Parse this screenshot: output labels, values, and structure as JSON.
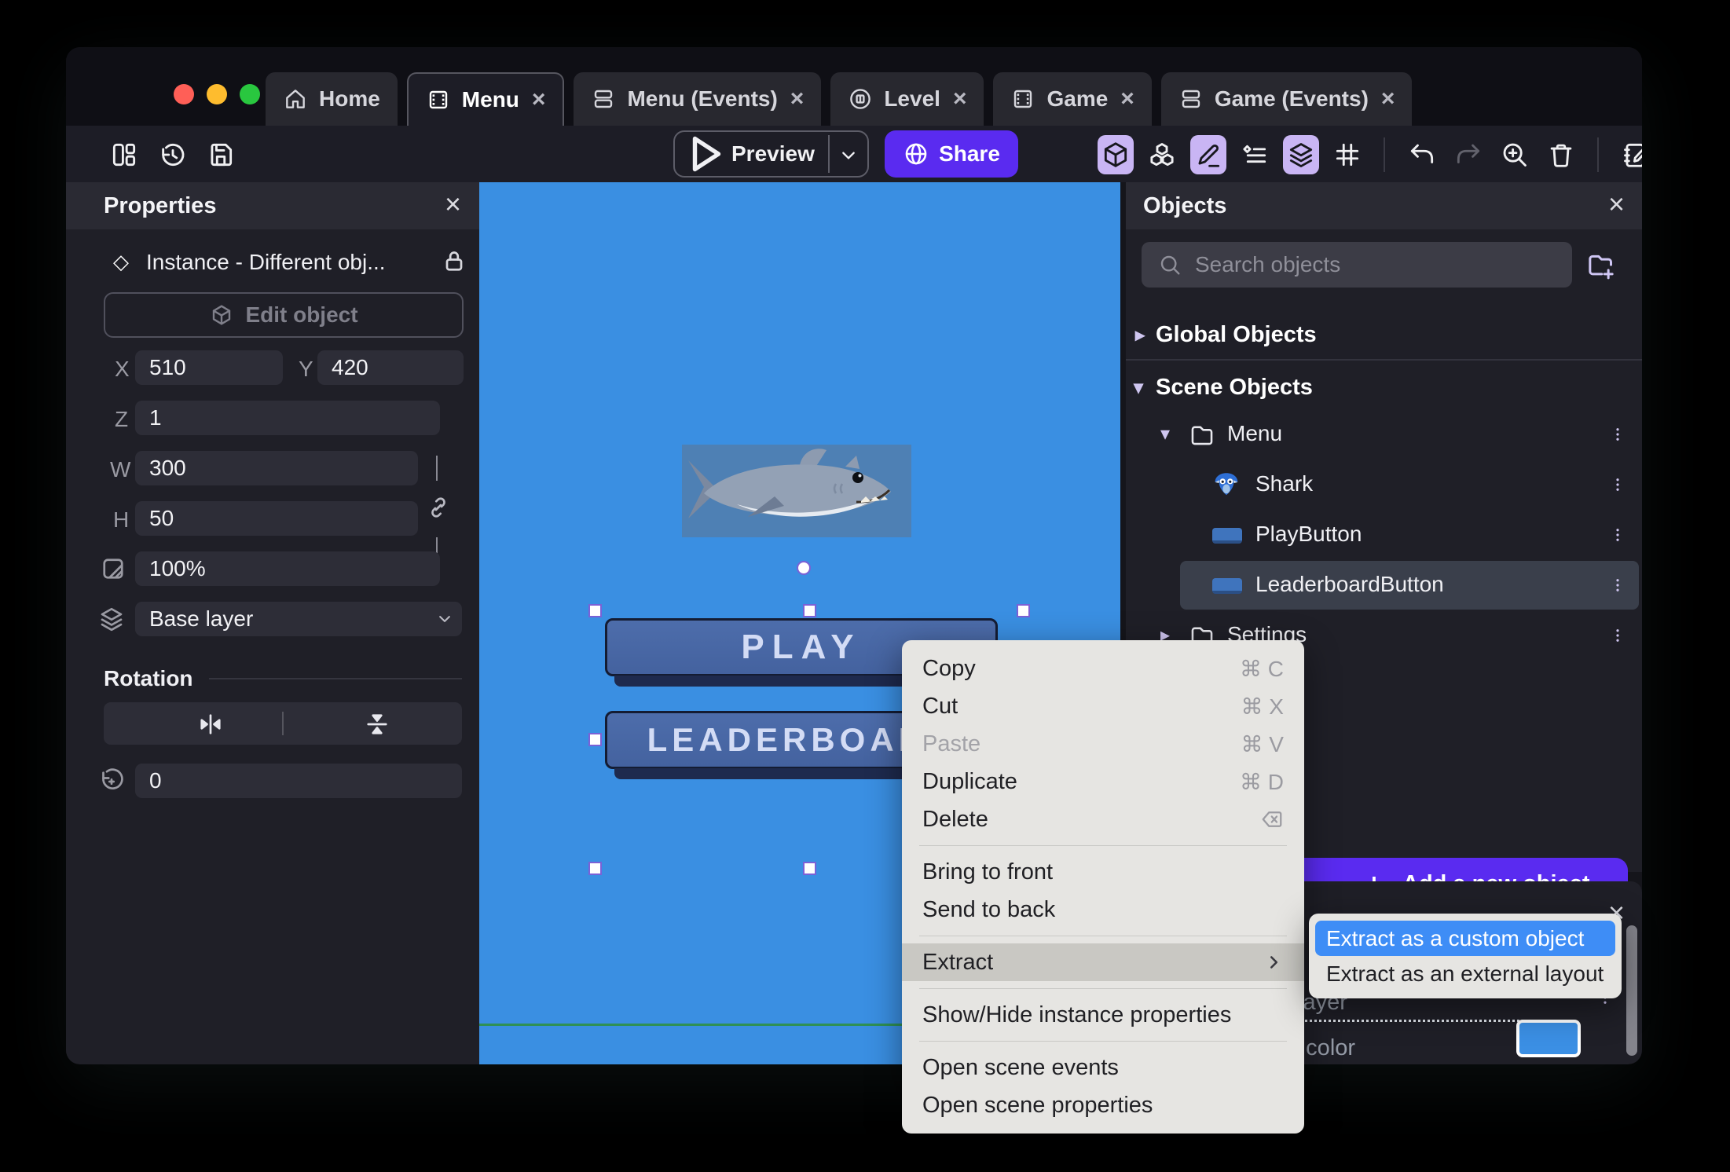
{
  "window_controls": {
    "close": "#ff5f57",
    "minimize": "#febc2e",
    "zoom": "#29c73f"
  },
  "tabs": [
    {
      "label": "Home",
      "icon": "home",
      "closable": false,
      "active": false
    },
    {
      "label": "Menu",
      "icon": "scene",
      "closable": true,
      "active": true
    },
    {
      "label": "Menu (Events)",
      "icon": "events",
      "closable": true,
      "active": false
    },
    {
      "label": "Level",
      "icon": "level",
      "closable": true,
      "active": false
    },
    {
      "label": "Game",
      "icon": "scene",
      "closable": true,
      "active": false
    },
    {
      "label": "Game (Events)",
      "icon": "events",
      "closable": true,
      "active": false
    }
  ],
  "toolbar": {
    "preview_label": "Preview",
    "share_label": "Share",
    "left_icons": [
      "panels",
      "history",
      "save"
    ],
    "right_icons": [
      {
        "name": "cube",
        "active": true
      },
      {
        "name": "cubes",
        "active": false
      },
      {
        "name": "pencil",
        "active": true
      },
      {
        "name": "instances",
        "active": false
      },
      {
        "name": "layers",
        "active": true
      },
      {
        "name": "grid",
        "active": false
      },
      {
        "divider": true
      },
      {
        "name": "undo",
        "active": false
      },
      {
        "name": "redo",
        "active": false,
        "dim": true
      },
      {
        "name": "zoomin",
        "active": false
      },
      {
        "name": "trash",
        "active": false
      },
      {
        "divider": true
      },
      {
        "name": "notebook",
        "active": false
      }
    ]
  },
  "properties_panel": {
    "title": "Properties",
    "instance_label": "Instance  -  Different obj...",
    "edit_object_label": "Edit object",
    "x_label": "X",
    "x_value": "510",
    "y_label": "Y",
    "y_value": "420",
    "z_label": "Z",
    "z_value": "1",
    "w_label": "W",
    "w_value": "300",
    "h_label": "H",
    "h_value": "50",
    "opacity_value": "100%",
    "layer_value": "Base layer",
    "rotation_title": "Rotation",
    "rotation_value": "0"
  },
  "canvas": {
    "background": "#3a8fe2",
    "play_button_label": "PLAY",
    "leaderboard_button_label": "LEADERBOARD",
    "scene_bottom_line_color": "#2f9055"
  },
  "objects_panel": {
    "title": "Objects",
    "search_placeholder": "Search objects",
    "global_section": "Global Objects",
    "scene_section": "Scene Objects",
    "tree": [
      {
        "label": "Menu",
        "type": "folder",
        "expanded": true,
        "depth": 0,
        "selected": false
      },
      {
        "label": "Shark",
        "type": "shark",
        "depth": 1,
        "selected": false
      },
      {
        "label": "PlayButton",
        "type": "button",
        "depth": 1,
        "selected": false
      },
      {
        "label": "LeaderboardButton",
        "type": "button",
        "depth": 1,
        "selected": true
      },
      {
        "label": "Settings",
        "type": "folder",
        "expanded": false,
        "depth": 0,
        "selected": false
      }
    ],
    "add_button_label": "Add a new object"
  },
  "layers_panel": {
    "layer_text_fragment": "layer",
    "color_text_fragment": "d color",
    "swatch_color": "#3b8fe4"
  },
  "context_menu": {
    "items": [
      {
        "label": "Copy",
        "shortcut": "⌘ C"
      },
      {
        "label": "Cut",
        "shortcut": "⌘ X"
      },
      {
        "label": "Paste",
        "shortcut": "⌘ V",
        "disabled": true
      },
      {
        "label": "Duplicate",
        "shortcut": "⌘ D"
      },
      {
        "label": "Delete",
        "shortcut_icon": "backspace"
      },
      {
        "divider": true
      },
      {
        "label": "Bring to front"
      },
      {
        "label": "Send to back"
      },
      {
        "divider": true
      },
      {
        "label": "Extract",
        "submenu": true,
        "highlighted": true
      },
      {
        "divider": true
      },
      {
        "label": "Show/Hide instance properties"
      },
      {
        "divider": true
      },
      {
        "label": "Open scene events"
      },
      {
        "label": "Open scene properties"
      }
    ],
    "submenu": [
      {
        "label": "Extract as a custom object",
        "highlighted": true
      },
      {
        "label": "Extract as an external layout",
        "highlighted": false
      }
    ]
  },
  "colors": {
    "accent_purple": "#5a2bf0",
    "icon_active_bg": "#c9b5f4",
    "submenu_highlight": "#3e8df6",
    "selected_row": "#3a3f4b"
  }
}
